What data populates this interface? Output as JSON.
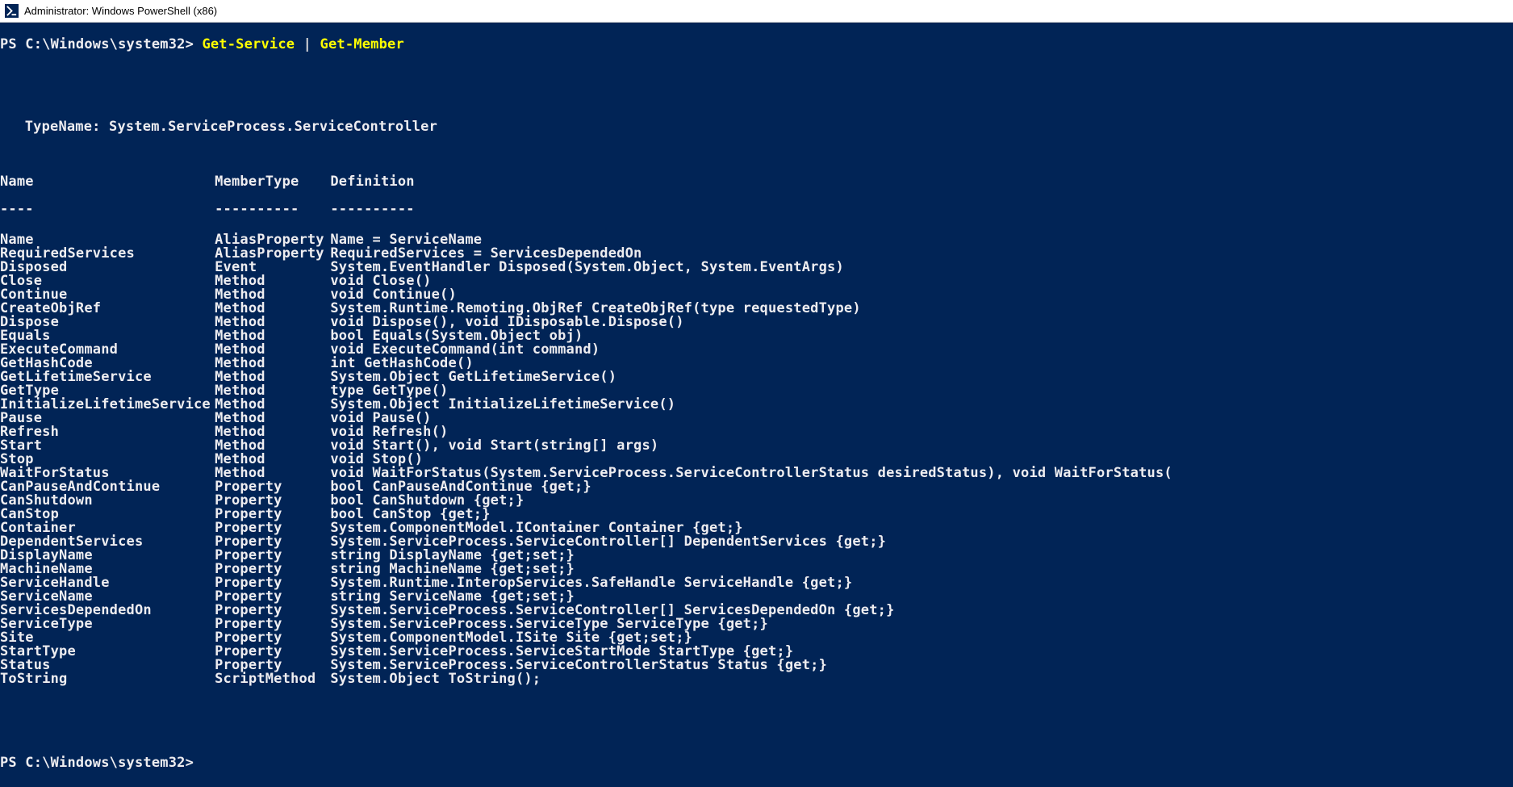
{
  "window": {
    "title": "Administrator: Windows PowerShell (x86)"
  },
  "prompt1": "PS C:\\Windows\\system32> ",
  "command1_a": "Get-Service ",
  "command1_pipe": "|",
  "command1_b": " Get-Member",
  "typename_line": "TypeName: System.ServiceProcess.ServiceController",
  "headers": {
    "name": "Name",
    "type": "MemberType",
    "def": "Definition"
  },
  "underlines": {
    "name": "----",
    "type": "----------",
    "def": "----------"
  },
  "rows": [
    {
      "name": "Name",
      "type": "AliasProperty",
      "def": "Name = ServiceName"
    },
    {
      "name": "RequiredServices",
      "type": "AliasProperty",
      "def": "RequiredServices = ServicesDependedOn"
    },
    {
      "name": "Disposed",
      "type": "Event",
      "def": "System.EventHandler Disposed(System.Object, System.EventArgs)"
    },
    {
      "name": "Close",
      "type": "Method",
      "def": "void Close()"
    },
    {
      "name": "Continue",
      "type": "Method",
      "def": "void Continue()"
    },
    {
      "name": "CreateObjRef",
      "type": "Method",
      "def": "System.Runtime.Remoting.ObjRef CreateObjRef(type requestedType)"
    },
    {
      "name": "Dispose",
      "type": "Method",
      "def": "void Dispose(), void IDisposable.Dispose()"
    },
    {
      "name": "Equals",
      "type": "Method",
      "def": "bool Equals(System.Object obj)"
    },
    {
      "name": "ExecuteCommand",
      "type": "Method",
      "def": "void ExecuteCommand(int command)"
    },
    {
      "name": "GetHashCode",
      "type": "Method",
      "def": "int GetHashCode()"
    },
    {
      "name": "GetLifetimeService",
      "type": "Method",
      "def": "System.Object GetLifetimeService()"
    },
    {
      "name": "GetType",
      "type": "Method",
      "def": "type GetType()"
    },
    {
      "name": "InitializeLifetimeService",
      "type": "Method",
      "def": "System.Object InitializeLifetimeService()"
    },
    {
      "name": "Pause",
      "type": "Method",
      "def": "void Pause()"
    },
    {
      "name": "Refresh",
      "type": "Method",
      "def": "void Refresh()"
    },
    {
      "name": "Start",
      "type": "Method",
      "def": "void Start(), void Start(string[] args)"
    },
    {
      "name": "Stop",
      "type": "Method",
      "def": "void Stop()"
    },
    {
      "name": "WaitForStatus",
      "type": "Method",
      "def": "void WaitForStatus(System.ServiceProcess.ServiceControllerStatus desiredStatus), void WaitForStatus("
    },
    {
      "name": "CanPauseAndContinue",
      "type": "Property",
      "def": "bool CanPauseAndContinue {get;}"
    },
    {
      "name": "CanShutdown",
      "type": "Property",
      "def": "bool CanShutdown {get;}"
    },
    {
      "name": "CanStop",
      "type": "Property",
      "def": "bool CanStop {get;}"
    },
    {
      "name": "Container",
      "type": "Property",
      "def": "System.ComponentModel.IContainer Container {get;}"
    },
    {
      "name": "DependentServices",
      "type": "Property",
      "def": "System.ServiceProcess.ServiceController[] DependentServices {get;}"
    },
    {
      "name": "DisplayName",
      "type": "Property",
      "def": "string DisplayName {get;set;}"
    },
    {
      "name": "MachineName",
      "type": "Property",
      "def": "string MachineName {get;set;}"
    },
    {
      "name": "ServiceHandle",
      "type": "Property",
      "def": "System.Runtime.InteropServices.SafeHandle ServiceHandle {get;}"
    },
    {
      "name": "ServiceName",
      "type": "Property",
      "def": "string ServiceName {get;set;}"
    },
    {
      "name": "ServicesDependedOn",
      "type": "Property",
      "def": "System.ServiceProcess.ServiceController[] ServicesDependedOn {get;}"
    },
    {
      "name": "ServiceType",
      "type": "Property",
      "def": "System.ServiceProcess.ServiceType ServiceType {get;}"
    },
    {
      "name": "Site",
      "type": "Property",
      "def": "System.ComponentModel.ISite Site {get;set;}"
    },
    {
      "name": "StartType",
      "type": "Property",
      "def": "System.ServiceProcess.ServiceStartMode StartType {get;}"
    },
    {
      "name": "Status",
      "type": "Property",
      "def": "System.ServiceProcess.ServiceControllerStatus Status {get;}"
    },
    {
      "name": "ToString",
      "type": "ScriptMethod",
      "def": "System.Object ToString();"
    }
  ],
  "prompt2": "PS C:\\Windows\\system32> "
}
